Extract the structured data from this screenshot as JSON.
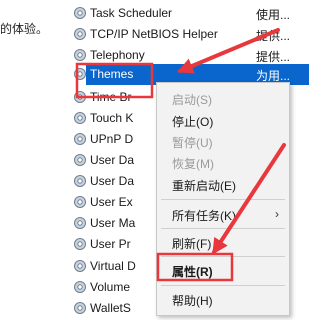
{
  "left_fragment": "的体验。",
  "services": [
    {
      "name": "Task Scheduler",
      "status": "使用..."
    },
    {
      "name": "TCP/IP NetBIOS Helper",
      "status": "提供..."
    },
    {
      "name": "Telephony",
      "status": "提供..."
    },
    {
      "name": "Themes",
      "status": "为用..."
    },
    {
      "name": "Time Br",
      "status": ""
    },
    {
      "name": "Touch K",
      "status": ""
    },
    {
      "name": "UPnP D",
      "status": ""
    },
    {
      "name": "User Da",
      "status": ""
    },
    {
      "name": "User Da",
      "status": ""
    },
    {
      "name": "User Ex",
      "status": ""
    },
    {
      "name": "User Ma",
      "status": ""
    },
    {
      "name": "User Pr",
      "status": ""
    },
    {
      "name": "Virtual D",
      "status": ""
    },
    {
      "name": "Volume",
      "status": ""
    },
    {
      "name": "WalletS",
      "status": ""
    }
  ],
  "selected_service": "Themes",
  "context_menu": {
    "start": "启动(S)",
    "stop": "停止(O)",
    "pause": "暂停(U)",
    "resume": "恢复(M)",
    "restart": "重新启动(E)",
    "all_tasks": "所有任务(K)",
    "refresh": "刷新(F)",
    "properties": "属性(R)",
    "help": "帮助(H)"
  },
  "annotation_color": "#e8383d",
  "selection_color": "#0a66cc"
}
